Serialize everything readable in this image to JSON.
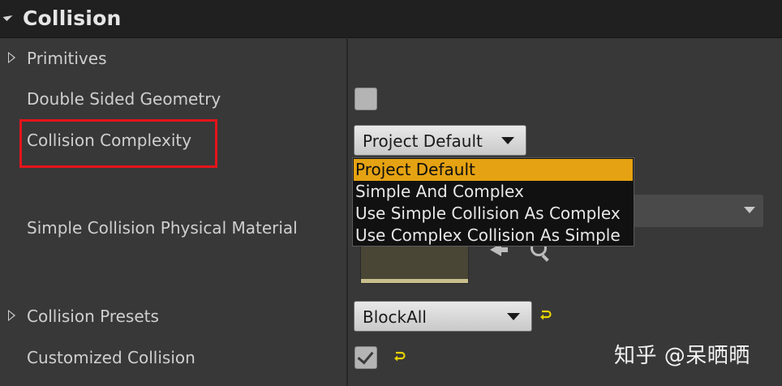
{
  "section": {
    "title": "Collision"
  },
  "properties": {
    "primitives": "Primitives",
    "double_sided": "Double Sided Geometry",
    "collision_complexity": "Collision Complexity",
    "physical_material": "Simple Collision Physical Material",
    "collision_presets": "Collision Presets",
    "customized_collision": "Customized Collision"
  },
  "controls": {
    "complexity_value": "Project Default",
    "presets_value": "BlockAll",
    "double_sided_checked": false,
    "customized_checked": true
  },
  "dropdown": {
    "options": [
      "Project Default",
      "Simple And Complex",
      "Use Simple Collision As Complex",
      "Use Complex Collision As Simple"
    ],
    "selected_index": 0
  },
  "colors": {
    "selected_highlight": "#e5a212",
    "annotation_border": "#e5141b",
    "reset_arrow": "#e8d100"
  },
  "icons": {
    "section_expander": "collapse-triangle-icon",
    "row_expander": "expand-triangle-icon",
    "use_selected": "arrow-left-icon",
    "browse": "magnifier-icon",
    "reset_to_default": "reset-arrow-icon"
  },
  "watermark": "知乎 @呆晒晒"
}
